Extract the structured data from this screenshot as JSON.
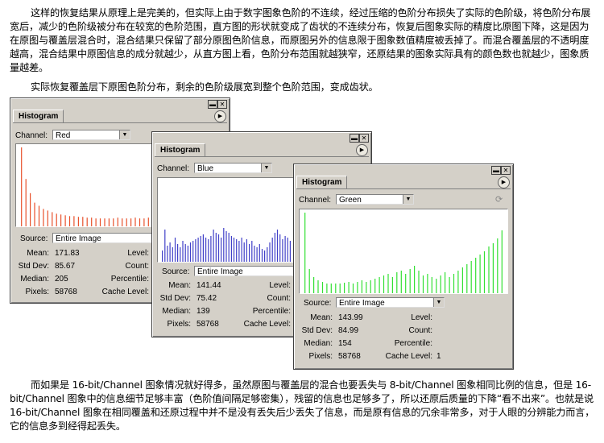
{
  "paragraphs": {
    "p1": "这样的恢复结果从原理上是完美的，但实际上由于数字图象色阶的不连续，经过压缩的色阶分布损失了实际的色阶级，将色阶分布展宽后，减少的色阶级被分布在较宽的色阶范围，直方图的形状就变成了齿状的不连续分布，恢复后图象实际的精度比原图下降，这是因为在原图与覆盖层混合时，混合结果只保留了部分原图色阶信息，而原图另外的信息限于图象数值精度被丢掉了。而混合覆盖层的不透明度越高，混合结果中原图信息的成分就越少，从直方图上看，色阶分布范围就越狭窄，还原结果的图象实际具有的颜色数也就越少，图象质量越差。",
    "p2": "实际恢复覆盖层下原图色阶分布，剩余的色阶级展宽到整个色阶范围，变成齿状。",
    "p3": "而如果是 16-bit/Channel 图象情况就好得多，虽然原图与覆盖层的混合也要丢失与 8-bit/Channel 图象相同比例的信息，但是 16-bit/Channel 图象中的信息细节足够丰富（色阶值间隔足够密集），残留的信息也足够多了，所以还原后质量的下降“看不出来”。也就是说 16-bit/Channel 图象在相同覆盖和还原过程中并不是没有丢失后少丢失了信息，而是原有信息的冗余非常多，对于人眼的分辨能力而言，它的信息多到经得起丢失。"
  },
  "labels": {
    "tab": "Histogram",
    "channel": "Channel:",
    "source": "Source:",
    "mean": "Mean:",
    "std_dev": "Std Dev:",
    "median": "Median:",
    "pixels": "Pixels:",
    "level": "Level:",
    "count": "Count:",
    "percentile": "Percentile:",
    "cache_level": "Cache Level:"
  },
  "icons": {
    "minimize": "minimize-icon",
    "close": "close-icon",
    "menu": "panel-menu-icon",
    "dropdown": "chevron-down-icon",
    "refresh": "refresh-icon"
  },
  "panels": [
    {
      "channel": "Red",
      "color": "#e8502a",
      "source": "Entire Image",
      "mean": "171.83",
      "std_dev": "85.67",
      "median": "205",
      "pixels": "58768",
      "level": "",
      "count": "",
      "percentile": "",
      "cache_level": ""
    },
    {
      "channel": "Blue",
      "color": "#4040c8",
      "source": "Entire Image",
      "mean": "141.44",
      "std_dev": "75.42",
      "median": "139",
      "pixels": "58768",
      "level": "",
      "count": "",
      "percentile": "",
      "cache_level": ""
    },
    {
      "channel": "Green",
      "color": "#33e033",
      "source": "Entire Image",
      "mean": "143.99",
      "std_dev": "84.99",
      "median": "154",
      "pixels": "58768",
      "level": "",
      "count": "",
      "percentile": "",
      "cache_level": "1"
    }
  ],
  "histograms": [
    [
      100,
      60,
      42,
      30,
      26,
      22,
      20,
      18,
      16,
      15,
      14,
      13,
      13,
      12,
      12,
      11,
      11,
      10,
      10,
      10,
      10,
      10,
      11,
      10,
      10,
      10,
      11,
      10,
      10,
      11,
      10,
      11,
      11,
      10,
      10,
      11,
      11,
      12,
      11,
      12,
      12,
      13,
      14,
      16,
      20,
      25
    ],
    [
      14,
      40,
      20,
      24,
      18,
      30,
      22,
      18,
      26,
      22,
      20,
      24,
      26,
      28,
      30,
      32,
      34,
      30,
      28,
      32,
      40,
      36,
      34,
      30,
      42,
      38,
      36,
      32,
      30,
      28,
      26,
      30,
      24,
      28,
      22,
      26,
      20,
      18,
      22,
      16,
      14,
      18,
      24,
      30,
      36,
      40,
      34,
      28,
      32,
      30,
      26
    ],
    [
      100,
      30,
      20,
      16,
      14,
      12,
      12,
      12,
      12,
      13,
      14,
      12,
      14,
      16,
      14,
      16,
      18,
      20,
      22,
      24,
      20,
      26,
      28,
      24,
      30,
      34,
      28,
      22,
      24,
      20,
      18,
      22,
      26,
      20,
      24,
      28,
      32,
      36,
      40,
      44,
      48,
      52,
      58,
      62,
      68,
      78
    ]
  ]
}
